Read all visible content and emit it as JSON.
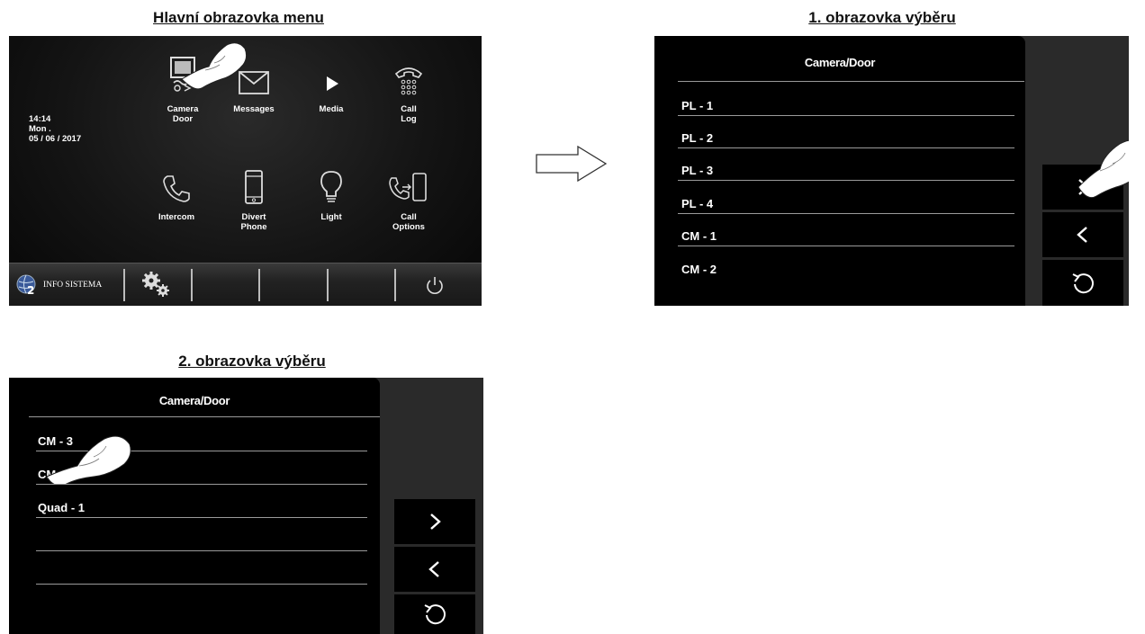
{
  "captions": {
    "main": "Hlavní obrazovka menu",
    "screen1": "1. obrazovka výběru",
    "screen2": "2. obrazovka výběru"
  },
  "main_screen": {
    "time": "14:14",
    "day": "Mon .",
    "date": "05 / 06 / 2017",
    "tiles": [
      {
        "label": "Camera\nDoor",
        "icon": "camera-door-icon"
      },
      {
        "label": "Messages",
        "icon": "envelope-icon"
      },
      {
        "label": "Media",
        "icon": "play-icon"
      },
      {
        "label": "Call\nLog",
        "icon": "phone-keypad-icon"
      },
      {
        "label": "Intercom",
        "icon": "handset-icon"
      },
      {
        "label": "Divert\nPhone",
        "icon": "mobile-phone-icon"
      },
      {
        "label": "Light",
        "icon": "light-bulb-icon"
      },
      {
        "label": "Call\nOptions",
        "icon": "call-transfer-icon"
      }
    ],
    "bottom": {
      "info_label": "INFO SISTEMA"
    }
  },
  "screen1": {
    "title": "Camera/Door",
    "items": [
      "PL - 1",
      "PL - 2",
      "PL - 3",
      "PL - 4",
      "CM - 1",
      "CM - 2"
    ]
  },
  "screen2": {
    "title": "Camera/Door",
    "items": [
      "CM - 3",
      "CM - 4",
      "Quad - 1"
    ]
  },
  "colors": {
    "screen_bg": "#000000",
    "side_panel": "#2a2a2a",
    "text": "#ffffff"
  }
}
